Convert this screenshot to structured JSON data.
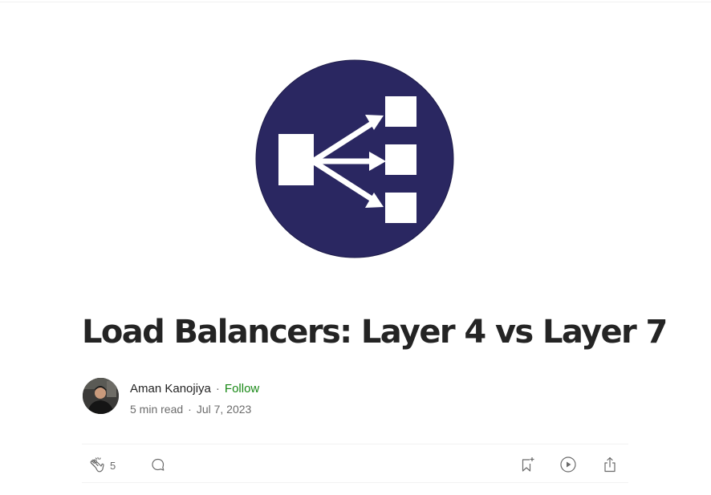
{
  "article": {
    "title": "Load Balancers: Layer 4 vs Layer 7",
    "hero_image": {
      "icon": "load-balancer-icon",
      "background_color": "#2a2761",
      "foreground_color": "#ffffff"
    }
  },
  "author": {
    "name": "Aman Kanojiya",
    "follow_label": "Follow",
    "separator": "·"
  },
  "meta": {
    "read_time": "5 min read",
    "separator": "·",
    "date": "Jul 7, 2023"
  },
  "actions": {
    "clap_icon": "clap-icon",
    "clap_count": "5",
    "comment_icon": "comment-icon",
    "bookmark_icon": "bookmark-add-icon",
    "listen_icon": "play-icon",
    "share_icon": "share-icon"
  },
  "colors": {
    "follow": "#1a8917",
    "text": "#242424",
    "muted": "#6b6b6b"
  }
}
